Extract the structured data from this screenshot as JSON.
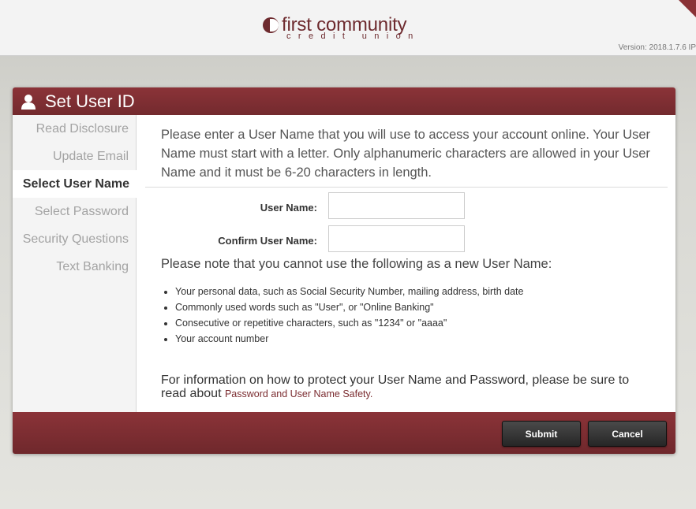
{
  "header": {
    "logo_main": "first community",
    "logo_sub": "credit union",
    "version": "Version: 2018.1.7.6 IP"
  },
  "panel": {
    "title": "Set User ID"
  },
  "sidebar": {
    "items": [
      {
        "label": "Read Disclosure",
        "active": false
      },
      {
        "label": "Update Email",
        "active": false
      },
      {
        "label": "Select User Name",
        "active": true
      },
      {
        "label": "Select Password",
        "active": false
      },
      {
        "label": "Security Questions",
        "active": false
      },
      {
        "label": "Text Banking",
        "active": false
      }
    ]
  },
  "main": {
    "intro": "Please enter a User Name that you will use to access your account online. Your User Name must start with a letter. Only alphanumeric characters are allowed in your User Name and it must be 6-20 characters in length.",
    "username_label": "User Name:",
    "username_value": "",
    "confirm_label": "Confirm User Name:",
    "confirm_value": "",
    "note": "Please note that you cannot use the following as a new User Name:",
    "rules": [
      "Your personal data, such as Social Security Number, mailing address, birth date",
      "Commonly used words such as \"User\", or \"Online Banking\"",
      "Consecutive or repetitive characters, such as \"1234\" or \"aaaa\"",
      "Your account number"
    ],
    "info_text": "For information on how to protect your User Name and Password, please be sure to read about",
    "info_link": "Password and User Name Safety."
  },
  "footer": {
    "submit_label": "Submit",
    "cancel_label": "Cancel"
  },
  "colors": {
    "brand": "#7b2c30",
    "header_bg": "#f3f3f3",
    "button_bg": "#333333"
  }
}
